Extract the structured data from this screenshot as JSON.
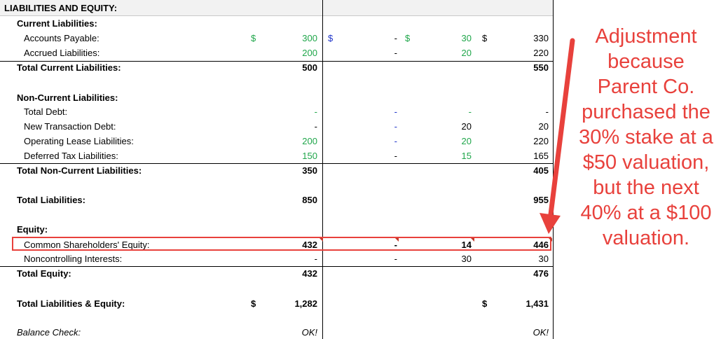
{
  "header": {
    "title": "LIABILITIES AND EQUITY:"
  },
  "rows": [
    {
      "label": "Current Liabilities:",
      "kind": "sec"
    },
    {
      "label": "Accounts Payable:",
      "kind": "ind",
      "s1": "$",
      "v1": "300",
      "c1": "green",
      "s2": "$",
      "v2": "-",
      "c2": "black",
      "s3": "$",
      "v3": "30",
      "c3": "green",
      "s4": "$",
      "v4": "330",
      "c4": "black"
    },
    {
      "label": "Accrued Liabilities:",
      "kind": "ind",
      "v1": "200",
      "c1": "green",
      "v2": "-",
      "c2": "black",
      "v3": "20",
      "c3": "green",
      "v4": "220",
      "c4": "black"
    },
    {
      "label": "Total Current Liabilities:",
      "kind": "top",
      "v1": "500",
      "c1": "black",
      "v4": "550",
      "c4": "black"
    },
    {
      "label": "Non-Current Liabilities:",
      "kind": "sec"
    },
    {
      "label": "Total Debt:",
      "kind": "ind",
      "v1": "-",
      "c1": "green",
      "v2": "-",
      "c2": "blue",
      "v3": "-",
      "c3": "green",
      "v4": "-",
      "c4": "black"
    },
    {
      "label": "New Transaction Debt:",
      "kind": "ind",
      "v1": "-",
      "c1": "black",
      "v2": "-",
      "c2": "blue",
      "v3": "20",
      "c3": "black",
      "v4": "20",
      "c4": "black"
    },
    {
      "label": "Operating Lease Liabilities:",
      "kind": "ind",
      "v1": "200",
      "c1": "green",
      "v2": "-",
      "c2": "blue",
      "v3": "20",
      "c3": "green",
      "v4": "220",
      "c4": "black"
    },
    {
      "label": "Deferred Tax Liabilities:",
      "kind": "ind",
      "v1": "150",
      "c1": "green",
      "v2": "-",
      "c2": "black",
      "v3": "15",
      "c3": "green",
      "v4": "165",
      "c4": "black"
    },
    {
      "label": "Total Non-Current Liabilities:",
      "kind": "top",
      "v1": "350",
      "c1": "black",
      "v4": "405",
      "c4": "black"
    },
    {
      "label": "Total Liabilities:",
      "kind": "top",
      "v1": "850",
      "c1": "black",
      "v4": "955",
      "c4": "black"
    },
    {
      "label": "Equity:",
      "kind": "sec"
    },
    {
      "label": "Common Shareholders' Equity:",
      "kind": "ind",
      "v1": "432",
      "c1": "black",
      "v2": "-",
      "c2": "black",
      "v3": "14",
      "c3": "black",
      "v4": "446",
      "c4": "black",
      "bold": true
    },
    {
      "label": "Noncontrolling Interests:",
      "kind": "ind",
      "v1": "-",
      "c1": "black",
      "v2": "-",
      "c2": "black",
      "v3": "30",
      "c3": "black",
      "v4": "30",
      "c4": "black"
    },
    {
      "label": "Total Equity:",
      "kind": "top",
      "v1": "432",
      "c1": "black",
      "v4": "476",
      "c4": "black"
    },
    {
      "label": "Total Liabilities & Equity:",
      "kind": "top",
      "s1": "$",
      "v1": "1,282",
      "c1": "black",
      "s4": "$",
      "v4": "1,431",
      "c4": "black",
      "bold": true
    },
    {
      "label": "Balance Check:",
      "kind": "bal",
      "v1": "OK!",
      "c1": "black",
      "v4": "OK!",
      "c4": "black",
      "italic": true
    }
  ],
  "annotation": {
    "lines": [
      "Adjustment",
      "because",
      "Parent Co.",
      "purchased the",
      "30% stake at a",
      "$50 valuation,",
      "but the next",
      "40% at a $100",
      "valuation."
    ],
    "color": "#e8413c"
  },
  "colors": {
    "input_green": "#1fa64a",
    "link_blue": "#1f35c9",
    "highlight_red": "#e8413c"
  }
}
